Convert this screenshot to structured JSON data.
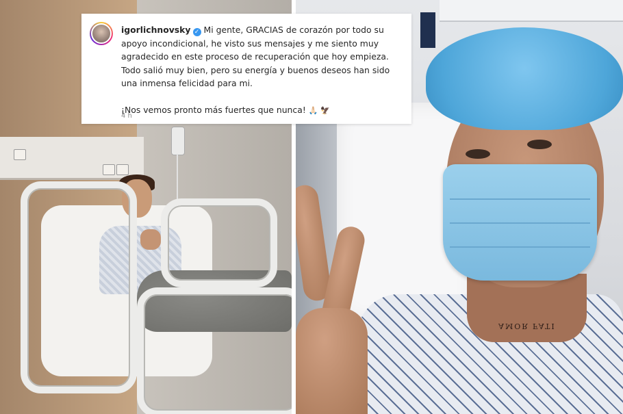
{
  "post": {
    "username": "igorlichnovsky",
    "verified_mark": "✓",
    "caption_paragraph_1": "Mi gente, GRACIAS de corazón por todo su apoyo incondicional, he visto sus mensajes y me siento muy agradecido en este proceso de recuperación que hoy empieza. Todo salió muy bien, pero su energía y buenos deseos han sido una inmensa felicidad para mi.",
    "caption_paragraph_2": "¡Nos vemos pronto más fuertes que nunca!",
    "emojis": "🙏🏻 🦅",
    "timestamp": "4 h",
    "verified_color": "#3897f0"
  },
  "photo_right": {
    "tattoo_text": "AMOR FATI"
  },
  "icons": {
    "avatar": "profile-avatar",
    "verified": "verified-badge-icon"
  }
}
